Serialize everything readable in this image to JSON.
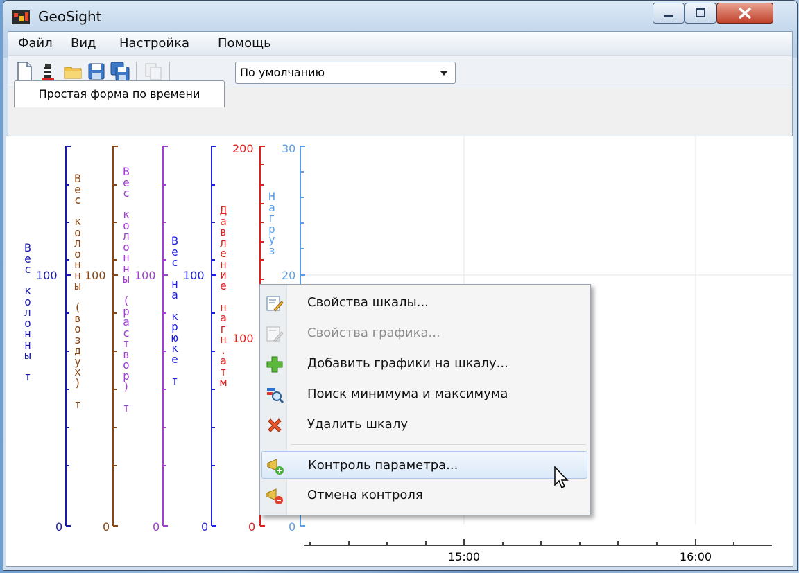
{
  "window": {
    "title": "GeoSight"
  },
  "menu": {
    "items": [
      "Файл",
      "Вид",
      "Настройка",
      "Помощь"
    ]
  },
  "toolbar": {
    "icons": [
      "new-file-icon",
      "lighthouse-icon",
      "open-folder-icon",
      "save-icon",
      "save-all-icon",
      "copy-disabled-icon"
    ],
    "profile_select": "По умолчанию"
  },
  "tab": {
    "label": "Простая форма по времени"
  },
  "axes": [
    {
      "label": "Вес колонны т",
      "color": "#1a1aa8",
      "ticks": [
        "100",
        "0"
      ]
    },
    {
      "label": "Вес колонны (воздух) т",
      "color": "#8b4513",
      "ticks": [
        "100",
        "0"
      ]
    },
    {
      "label": "Вес колонны (раствор) т",
      "color": "#a040d0",
      "ticks": [
        "100",
        "0"
      ]
    },
    {
      "label": "Вес на крюке т",
      "color": "#2020e0",
      "ticks": [
        "100",
        "0"
      ]
    },
    {
      "label": "Давление нагн.атм",
      "color": "#e02020",
      "ticks": [
        "200",
        "100",
        "0"
      ]
    },
    {
      "label": "Нагруз",
      "color": "#5aa0e8",
      "ticks": [
        "30",
        "20",
        "0"
      ]
    }
  ],
  "time_axis": {
    "ticks": [
      "15:00",
      "16:00"
    ]
  },
  "context_menu": {
    "items": [
      {
        "label": "Свойства шкалы...",
        "icon": "scale-properties-icon",
        "enabled": true
      },
      {
        "label": "Свойства графика...",
        "icon": "chart-properties-icon",
        "enabled": false
      },
      {
        "label": "Добавить графики на шкалу...",
        "icon": "add-plus-icon",
        "enabled": true
      },
      {
        "label": "Поиск минимума и максимума",
        "icon": "search-minmax-icon",
        "enabled": true
      },
      {
        "label": "Удалить шкалу",
        "icon": "delete-x-icon",
        "enabled": true
      },
      {
        "label": "Контроль параметра...",
        "icon": "control-add-icon",
        "enabled": true,
        "hover": true
      },
      {
        "label": "Отмена контроля",
        "icon": "control-remove-icon",
        "enabled": true
      }
    ]
  }
}
